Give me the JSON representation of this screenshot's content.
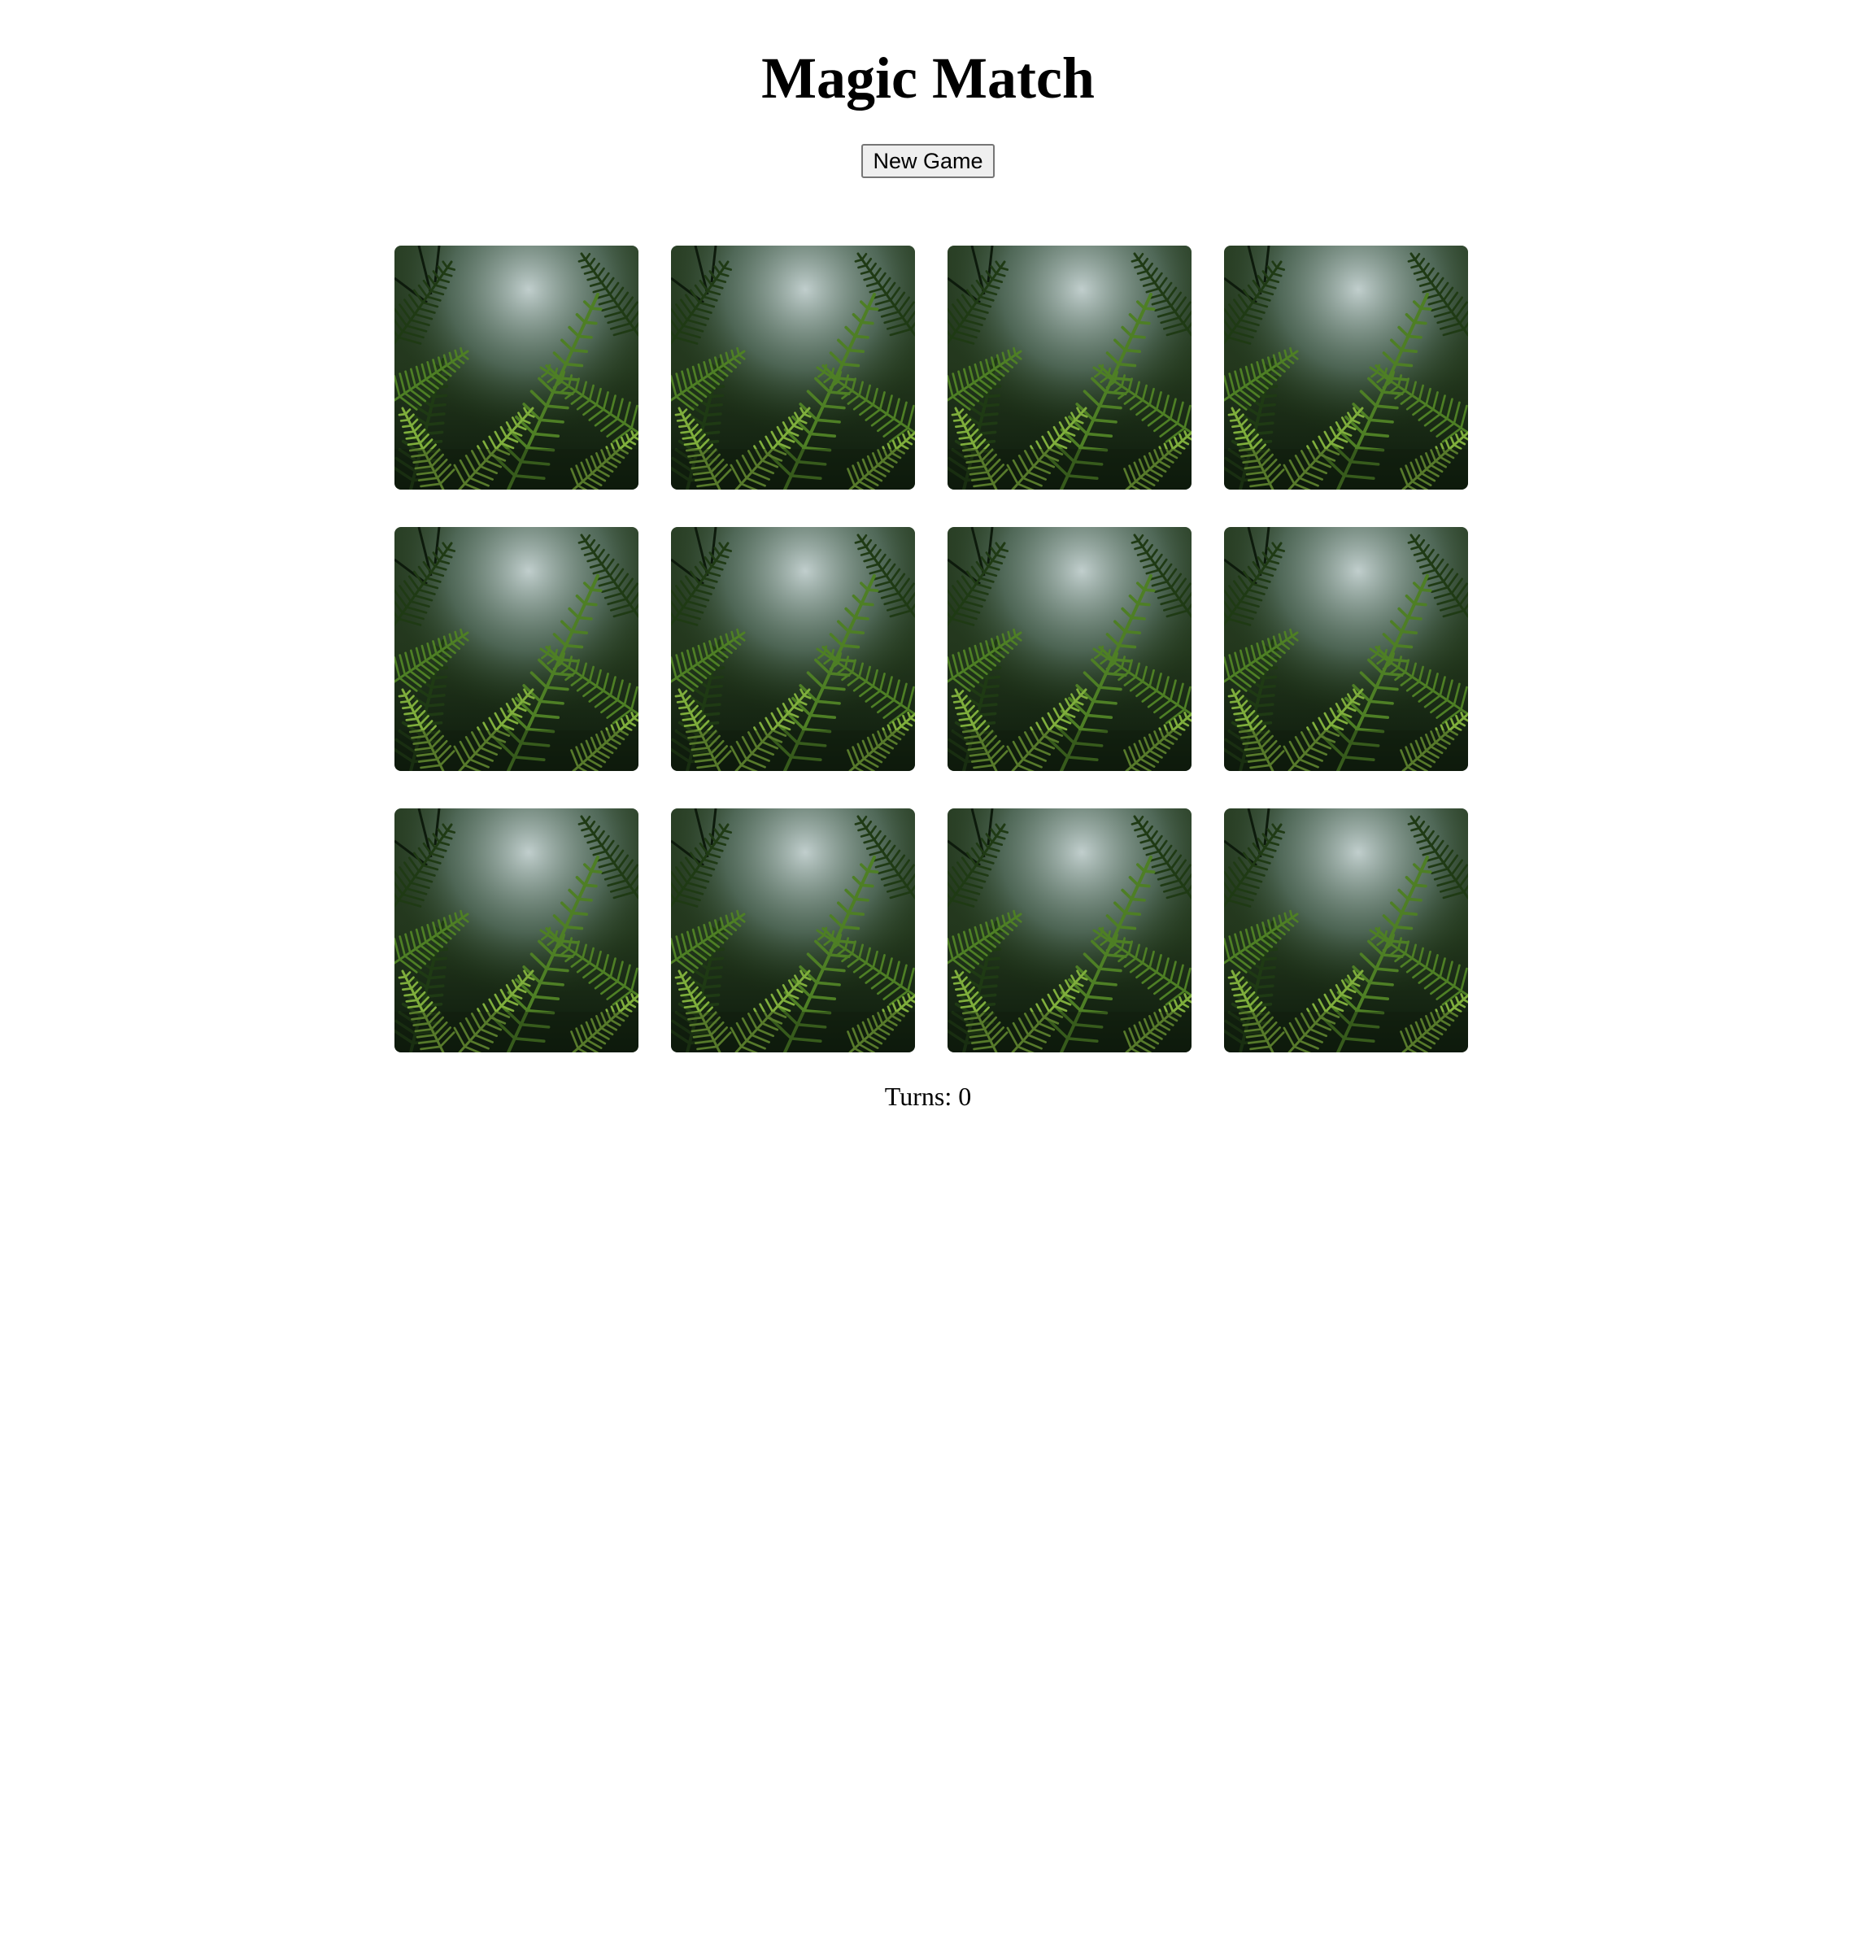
{
  "title": "Magic Match",
  "new_game_label": "New Game",
  "turns": {
    "label": "Turns:",
    "value": 0
  },
  "cards": [
    {
      "state": "face-down",
      "back_image": "forest-fern-card-back"
    },
    {
      "state": "face-down",
      "back_image": "forest-fern-card-back"
    },
    {
      "state": "face-down",
      "back_image": "forest-fern-card-back"
    },
    {
      "state": "face-down",
      "back_image": "forest-fern-card-back"
    },
    {
      "state": "face-down",
      "back_image": "forest-fern-card-back"
    },
    {
      "state": "face-down",
      "back_image": "forest-fern-card-back"
    },
    {
      "state": "face-down",
      "back_image": "forest-fern-card-back"
    },
    {
      "state": "face-down",
      "back_image": "forest-fern-card-back"
    },
    {
      "state": "face-down",
      "back_image": "forest-fern-card-back"
    },
    {
      "state": "face-down",
      "back_image": "forest-fern-card-back"
    },
    {
      "state": "face-down",
      "back_image": "forest-fern-card-back"
    },
    {
      "state": "face-down",
      "back_image": "forest-fern-card-back"
    }
  ],
  "colors": {
    "mist": "#c9d6d6",
    "fern_light": "#7fae3c",
    "fern_mid": "#4e7f25",
    "fern_dark": "#1f3a14",
    "shadow": "#0d1a0c"
  }
}
